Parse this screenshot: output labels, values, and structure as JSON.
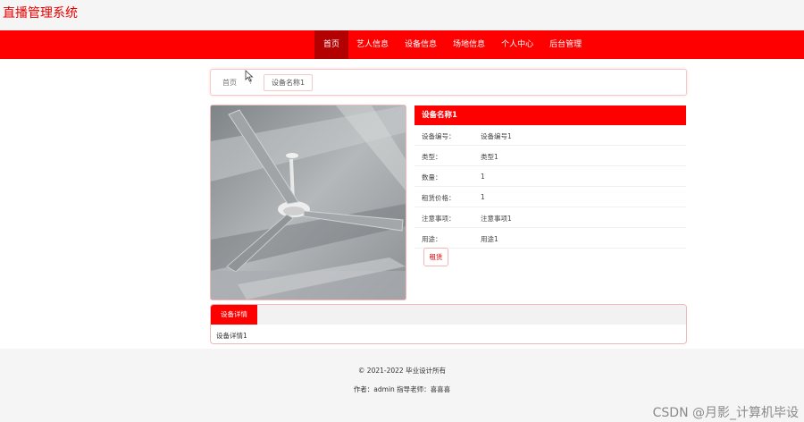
{
  "header": {
    "title": "直播管理系统"
  },
  "nav": {
    "items": [
      {
        "label": "首页",
        "active": true
      },
      {
        "label": "艺人信息"
      },
      {
        "label": "设备信息"
      },
      {
        "label": "场地信息"
      },
      {
        "label": "个人中心"
      },
      {
        "label": "后台管理"
      }
    ]
  },
  "breadcrumb": {
    "home": "首页",
    "separator": "/",
    "current": "设备名称1"
  },
  "photo": {
    "icon": "ceiling-fan-photo"
  },
  "detail": {
    "title": "设备名称1",
    "fields": [
      {
        "label": "设备编号：",
        "value": "设备编号1"
      },
      {
        "label": "类型：",
        "value": "类型1"
      },
      {
        "label": "数量：",
        "value": "1"
      },
      {
        "label": "租赁价格：",
        "value": "1"
      },
      {
        "label": "注意事项：",
        "value": "注意事项1"
      },
      {
        "label": "用途：",
        "value": "用途1"
      }
    ],
    "rent_button": "租赁"
  },
  "tabs": {
    "active_tab": "设备详情",
    "content": "设备详情1"
  },
  "footer": {
    "copyright": "© 2021-2022 毕业设计所有",
    "author": "作者：admin 指导老师：喜喜喜"
  },
  "watermark": "CSDN @月影_计算机毕设",
  "colors": {
    "primary": "#ff0000",
    "nav_active": "#b30000",
    "footer_bg": "#f5f5f5"
  }
}
